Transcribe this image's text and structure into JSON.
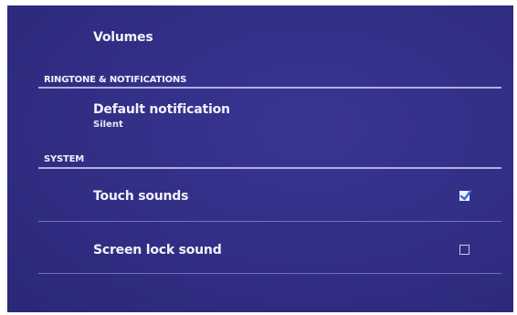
{
  "settings": {
    "volumes": {
      "title": "Volumes"
    },
    "ringtone_section": {
      "label": "RINGTONE & NOTIFICATIONS"
    },
    "default_notification": {
      "title": "Default notification",
      "summary": "Silent"
    },
    "system_section": {
      "label": "SYSTEM"
    },
    "touch_sounds": {
      "title": "Touch sounds",
      "checked": true
    },
    "screen_lock_sound": {
      "title": "Screen lock sound",
      "checked": false
    }
  },
  "colors": {
    "background": "#322f86",
    "checkbox_checked": "#e9f1ff",
    "check_mark": "#2f6bd6"
  },
  "icons": {
    "check": "check-icon"
  }
}
